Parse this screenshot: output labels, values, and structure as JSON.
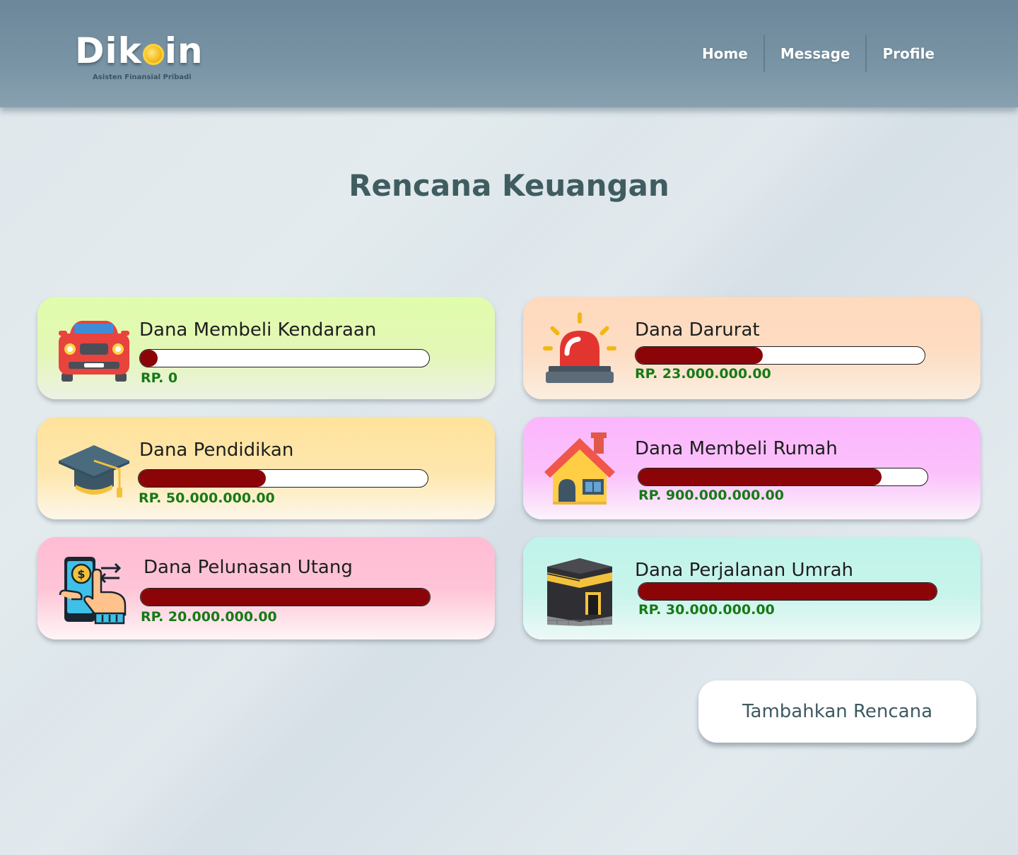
{
  "app": {
    "brand": {
      "name_start": "Dik",
      "name_end": "in",
      "tagline": "Asisten Finansial Pribadi"
    },
    "nav": {
      "home": "Home",
      "message": "Message",
      "profile": "Profile"
    }
  },
  "page": {
    "title": "Rencana Keuangan"
  },
  "plans": [
    {
      "title": "Dana Membeli Kendaraan",
      "amount": "RP.  0",
      "progress": 0.06,
      "icon": "car-icon"
    },
    {
      "title": "Dana Darurat",
      "amount": "RP. 23.000.000.00",
      "progress": 0.44,
      "icon": "siren-icon"
    },
    {
      "title": "Dana Pendidikan",
      "amount": "RP.  50.000.000.00",
      "progress": 0.44,
      "icon": "graduation-cap-icon"
    },
    {
      "title": "Dana Membeli Rumah",
      "amount": "RP. 900.000.000.00",
      "progress": 0.84,
      "icon": "house-icon"
    },
    {
      "title": "Dana Pelunasan Utang",
      "amount": "RP. 20.000.000.00",
      "progress": 1.0,
      "icon": "mobile-payment-icon"
    },
    {
      "title": "Dana Perjalanan Umrah",
      "amount": "RP. 30.000.000.00",
      "progress": 1.0,
      "icon": "kaaba-icon"
    }
  ],
  "actions": {
    "add_plan": "Tambahkan Rencana"
  },
  "colors": {
    "progress_fill": "#8b0508",
    "amount_text": "#167a16",
    "title_text": "#3f5d60"
  }
}
